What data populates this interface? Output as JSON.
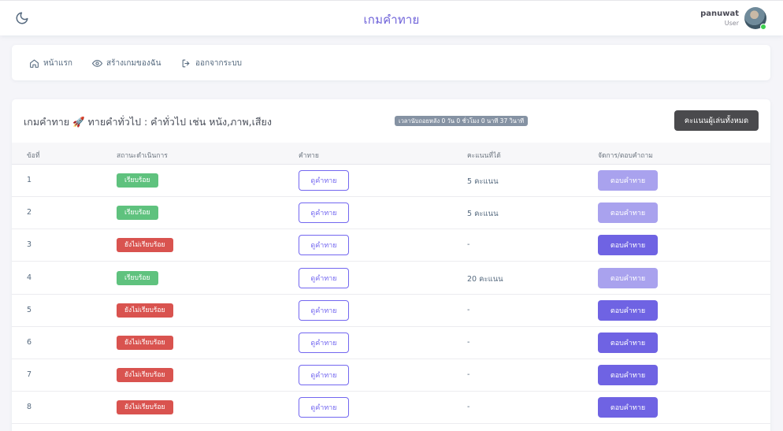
{
  "header": {
    "title": "เกมคำทาย",
    "user_name": "panuwat",
    "user_role": "User",
    "theme_icon": "moon-icon"
  },
  "nav": {
    "items": [
      {
        "label": "หน้าแรก",
        "icon": "home-icon"
      },
      {
        "label": "สร้างเกมของฉัน",
        "icon": "eye-icon"
      },
      {
        "label": "ออกจากระบบ",
        "icon": "logout-icon"
      }
    ]
  },
  "game": {
    "title": "เกมคำทาย 🚀 ทายคำทั่วไป : คำทั่วไป เช่น หนัง,ภาพ,เสียง",
    "countdown": "เวลานับถอยหลัง 0 วัน 0 ชั่วโมง 0 นาที 37 วินาที",
    "all_scores_label": "คะแนนผู้เล่นทั้งหมด"
  },
  "table": {
    "headers": [
      "ข้อที่",
      "สถานะดำเนินการ",
      "คำทาย",
      "คะแนนที่ได้",
      "จัดการ/ตอบคำถาม"
    ],
    "view_label": "ดูคำทาย",
    "answer_label": "ตอบคำทาย",
    "rows": [
      {
        "no": "1",
        "status": "เรียบร้อย",
        "status_type": "ok",
        "score": "5 คะแนน"
      },
      {
        "no": "2",
        "status": "เรียบร้อย",
        "status_type": "ok",
        "score": "5 คะแนน"
      },
      {
        "no": "3",
        "status": "ยังไม่เรียบร้อย",
        "status_type": "no",
        "score": "-"
      },
      {
        "no": "4",
        "status": "เรียบร้อย",
        "status_type": "ok",
        "score": "20 คะแนน"
      },
      {
        "no": "5",
        "status": "ยังไม่เรียบร้อย",
        "status_type": "no",
        "score": "-"
      },
      {
        "no": "6",
        "status": "ยังไม่เรียบร้อย",
        "status_type": "no",
        "score": "-"
      },
      {
        "no": "7",
        "status": "ยังไม่เรียบร้อย",
        "status_type": "no",
        "score": "-"
      },
      {
        "no": "8",
        "status": "ยังไม่เรียบร้อย",
        "status_type": "no",
        "score": "-"
      }
    ]
  },
  "colors": {
    "accent": "#7367f0",
    "success": "#5fc27e",
    "danger": "#d9534f",
    "dark_button": "#4a4a4d"
  }
}
